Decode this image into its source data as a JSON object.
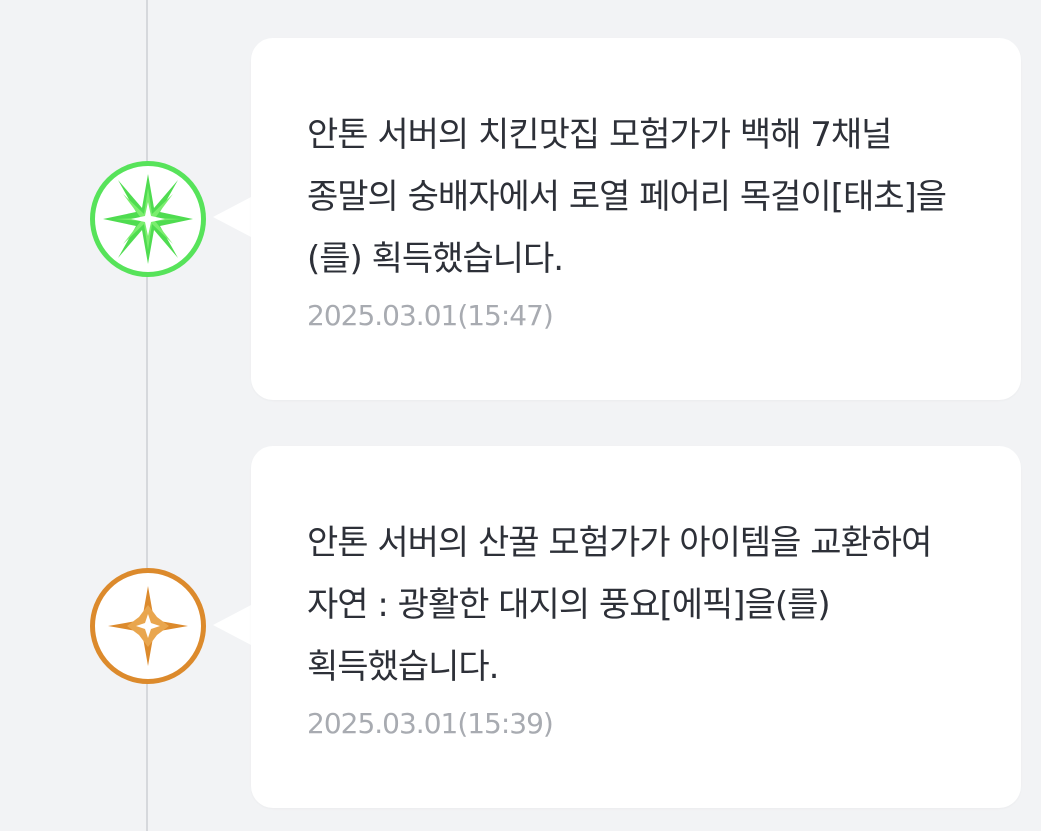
{
  "timeline": {
    "items": [
      {
        "icon": "green-star-burst-icon",
        "accent": "#57e35a",
        "message": "안톤 서버의 치킨맛집 모험가가 백해 7채널 종말의 숭배자에서 로열 페어리 목걸이[태초]을(를) 획득했습니다.",
        "time": "2025.03.01(15:47)"
      },
      {
        "icon": "orange-four-point-star-icon",
        "accent": "#dc8a2c",
        "message": "안톤 서버의 산꿀 모험가가 아이템을 교환하여 자연 : 광활한 대지의 풍요[에픽]을(를) 획득했습니다.",
        "time": "2025.03.01(15:39)"
      }
    ]
  }
}
